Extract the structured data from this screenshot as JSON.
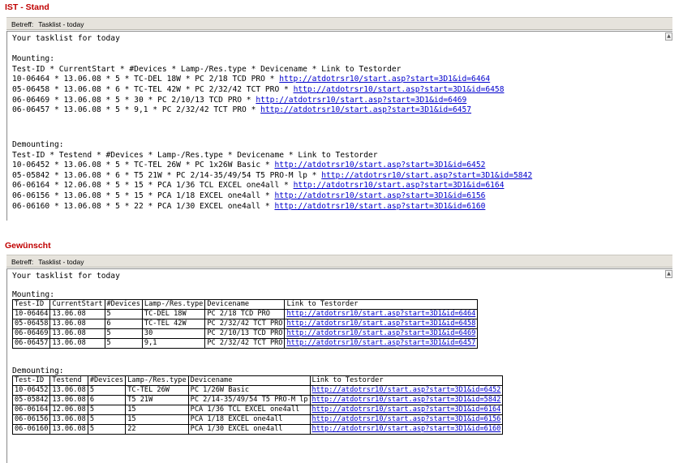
{
  "ist": {
    "heading": "IST - Stand",
    "subject_label": "Betreff:",
    "subject_value": "Tasklist - today",
    "intro": "Your tasklist for today",
    "mounting": {
      "label": "Mounting:",
      "header": "Test-ID * CurrentStart * #Devices * Lamp-/Res.type * Devicename * Link to Testorder",
      "rows": [
        {
          "text": "10-06464 * 13.06.08 * 5 * TC-DEL 18W * PC 2/18 TCD PRO * ",
          "link": "http://atdotrsr10/start.asp?start=3D1&id=6464"
        },
        {
          "text": "05-06458 * 13.06.08 * 6 * TC-TEL 42W * PC 2/32/42 TCT PRO * ",
          "link": "http://atdotrsr10/start.asp?start=3D1&id=6458"
        },
        {
          "text": "06-06469 * 13.06.08 * 5 * 30 * PC 2/10/13 TCD PRO * ",
          "link": "http://atdotrsr10/start.asp?start=3D1&id=6469"
        },
        {
          "text": "06-06457 * 13.06.08 * 5 * 9,1 * PC 2/32/42 TCT PRO * ",
          "link": "http://atdotrsr10/start.asp?start=3D1&id=6457"
        }
      ]
    },
    "demounting": {
      "label": "Demounting:",
      "header": "Test-ID * Testend * #Devices * Lamp-/Res.type * Devicename * Link to Testorder",
      "rows": [
        {
          "text": "10-06452 * 13.06.08 * 5 * TC-TEL 26W * PC 1x26W Basic * ",
          "link": "http://atdotrsr10/start.asp?start=3D1&id=6452"
        },
        {
          "text": "05-05842 * 13.06.08 * 6 * T5 21W * PC 2/14-35/49/54 T5 PRO-M lp * ",
          "link": "http://atdotrsr10/start.asp?start=3D1&id=5842"
        },
        {
          "text": "06-06164 * 12.06.08 * 5 * 15 * PCA 1/36 TCL EXCEL one4all * ",
          "link": "http://atdotrsr10/start.asp?start=3D1&id=6164"
        },
        {
          "text": "06-06156 * 13.06.08 * 5 * 15 * PCA 1/18 EXCEL one4all * ",
          "link": "http://atdotrsr10/start.asp?start=3D1&id=6156"
        },
        {
          "text": "06-06160 * 13.06.08 * 5 * 22 * PCA 1/30 EXCEL one4all * ",
          "link": "http://atdotrsr10/start.asp?start=3D1&id=6160"
        }
      ]
    }
  },
  "soll": {
    "heading": "Gewünscht",
    "subject_label": "Betreff:",
    "subject_value": "Tasklist - today",
    "intro": "Your tasklist for today",
    "mounting": {
      "label": "Mounting:",
      "columns": [
        "Test-ID",
        "CurrentStart",
        "#Devices",
        "Lamp-/Res.type",
        "Devicename",
        "Link to Testorder"
      ],
      "rows": [
        [
          "10-06464",
          "13.06.08",
          "5",
          "TC-DEL 18W",
          "PC 2/18 TCD PRO",
          "http://atdotrsr10/start.asp?start=3D1&id=6464"
        ],
        [
          "05-06458",
          "13.06.08",
          "6",
          "TC-TEL 42W",
          "PC 2/32/42 TCT PRO",
          "http://atdotrsr10/start.asp?start=3D1&id=6458"
        ],
        [
          "06-06469",
          "13.06.08",
          "5",
          "30",
          "PC 2/10/13 TCD PRO",
          "http://atdotrsr10/start.asp?start=3D1&id=6469"
        ],
        [
          "06-06457",
          "13.06.08",
          "5",
          "9,1",
          "PC 2/32/42 TCT PRO",
          "http://atdotrsr10/start.asp?start=3D1&id=6457"
        ]
      ]
    },
    "demounting": {
      "label": "Demounting:",
      "columns": [
        "Test-ID",
        "Testend",
        "#Devices",
        "Lamp-/Res.type",
        "Devicename",
        "Link to Testorder"
      ],
      "rows": [
        [
          "10-06452",
          "13.06.08",
          "5",
          "TC-TEL 26W",
          "PC 1/26W Basic",
          "http://atdotrsr10/start.asp?start=3D1&id=6452"
        ],
        [
          "05-05842",
          "13.06.08",
          "6",
          "T5 21W",
          "PC 2/14-35/49/54 T5 PRO-M lp",
          "http://atdotrsr10/start.asp?start=3D1&id=5842"
        ],
        [
          "06-06164",
          "12.06.08",
          "5",
          "15",
          "PCA 1/36 TCL EXCEL one4all",
          "http://atdotrsr10/start.asp?start=3D1&id=6164"
        ],
        [
          "06-06156",
          "13.06.08",
          "5",
          "15",
          "PCA 1/18 EXCEL one4all",
          "http://atdotrsr10/start.asp?start=3D1&id=6156"
        ],
        [
          "06-06160",
          "13.06.08",
          "5",
          "22",
          "PCA 1/30 EXCEL one4all",
          "http://atdotrsr10/start.asp?start=3D1&id=6160"
        ]
      ]
    }
  },
  "icons": {
    "scroll_up": "scroll-up-arrow-icon"
  },
  "colors": {
    "heading": "#c00000",
    "link": "#0000cc",
    "subject_bar": "#e6e3dc"
  }
}
